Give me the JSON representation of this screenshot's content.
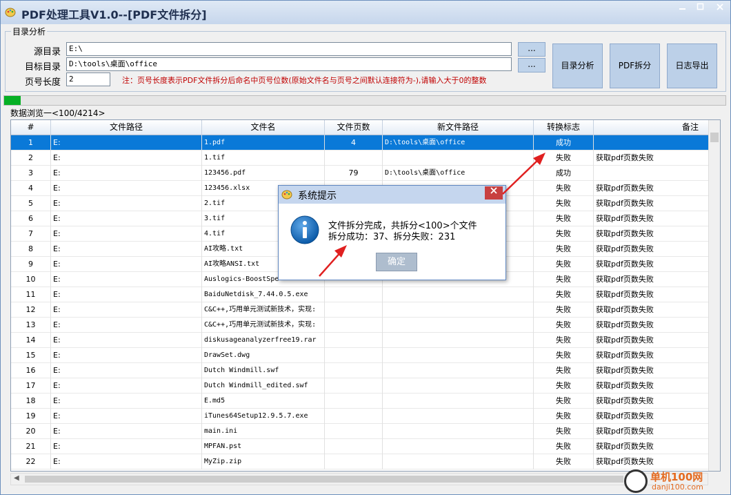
{
  "window": {
    "title": "PDF处理工具V1.0--[PDF文件拆分]"
  },
  "group": {
    "legend": "目录分析",
    "source_label": "源目录",
    "source_value": "E:\\",
    "target_label": "目标目录",
    "target_value": "D:\\tools\\桌面\\office",
    "pagelen_label": "页号长度",
    "pagelen_value": "2",
    "browse_label": "...",
    "note": "注：页号长度表示PDF文件拆分后命名中页号位数(原始文件名与页号之间默认连接符为-),请输入大于0的整数",
    "btn_analyze": "目录分析",
    "btn_split": "PDF拆分",
    "btn_export": "日志导出"
  },
  "progress": {
    "fraction": 0.023
  },
  "section": {
    "label": "数据浏览一<100/4214>"
  },
  "grid": {
    "columns": [
      "#",
      "文件路径",
      "文件名",
      "文件页数",
      "新文件路径",
      "转换标志",
      "备注"
    ],
    "rows": [
      [
        "1",
        "E:",
        "1.pdf",
        "4",
        "D:\\tools\\桌面\\office",
        "成功",
        ""
      ],
      [
        "2",
        "E:",
        "1.tif",
        "",
        "",
        "失败",
        "获取pdf页数失败"
      ],
      [
        "3",
        "E:",
        "123456.pdf",
        "79",
        "D:\\tools\\桌面\\office",
        "成功",
        ""
      ],
      [
        "4",
        "E:",
        "123456.xlsx",
        "",
        "",
        "失败",
        "获取pdf页数失败"
      ],
      [
        "5",
        "E:",
        "2.tif",
        "",
        "",
        "失败",
        "获取pdf页数失败"
      ],
      [
        "6",
        "E:",
        "3.tif",
        "",
        "",
        "失败",
        "获取pdf页数失败"
      ],
      [
        "7",
        "E:",
        "4.tif",
        "",
        "",
        "失败",
        "获取pdf页数失败"
      ],
      [
        "8",
        "E:",
        "AI攻略.txt",
        "",
        "",
        "失败",
        "获取pdf页数失败"
      ],
      [
        "9",
        "E:",
        "AI攻略ANSI.txt",
        "",
        "",
        "失败",
        "获取pdf页数失败"
      ],
      [
        "10",
        "E:",
        "Auslogics-BoostSpe",
        "",
        "",
        "失败",
        "获取pdf页数失败"
      ],
      [
        "11",
        "E:",
        "BaiduNetdisk_7.44.0.5.exe",
        "",
        "",
        "失败",
        "获取pdf页数失败"
      ],
      [
        "12",
        "E:",
        "C&C++,巧用单元测试新技术，实现:",
        "",
        "",
        "失败",
        "获取pdf页数失败"
      ],
      [
        "13",
        "E:",
        "C&C++,巧用单元测试新技术，实现:",
        "",
        "",
        "失败",
        "获取pdf页数失败"
      ],
      [
        "14",
        "E:",
        "diskusageanalyzerfree19.rar",
        "",
        "",
        "失败",
        "获取pdf页数失败"
      ],
      [
        "15",
        "E:",
        "DrawSet.dwg",
        "",
        "",
        "失败",
        "获取pdf页数失败"
      ],
      [
        "16",
        "E:",
        "Dutch Windmill.swf",
        "",
        "",
        "失败",
        "获取pdf页数失败"
      ],
      [
        "17",
        "E:",
        "Dutch Windmill_edited.swf",
        "",
        "",
        "失败",
        "获取pdf页数失败"
      ],
      [
        "18",
        "E:",
        "E.md5",
        "",
        "",
        "失败",
        "获取pdf页数失败"
      ],
      [
        "19",
        "E:",
        "iTunes64Setup12.9.5.7.exe",
        "",
        "",
        "失败",
        "获取pdf页数失败"
      ],
      [
        "20",
        "E:",
        "main.ini",
        "",
        "",
        "失败",
        "获取pdf页数失败"
      ],
      [
        "21",
        "E:",
        "MPFAN.pst",
        "",
        "",
        "失败",
        "获取pdf页数失败"
      ],
      [
        "22",
        "E:",
        "MyZip.zip",
        "",
        "",
        "失败",
        "获取pdf页数失败"
      ]
    ]
  },
  "dialog": {
    "title": "系统提示",
    "line1": "文件拆分完成，共拆分<100>个文件",
    "line2": "拆分成功：37、拆分失败：231",
    "ok": "确定"
  },
  "watermark": {
    "brand": "单机100网",
    "url": "danji100.com"
  },
  "colors": {
    "selected_row": "#0a79d8",
    "progress": "#06b025",
    "note": "#c00000"
  }
}
